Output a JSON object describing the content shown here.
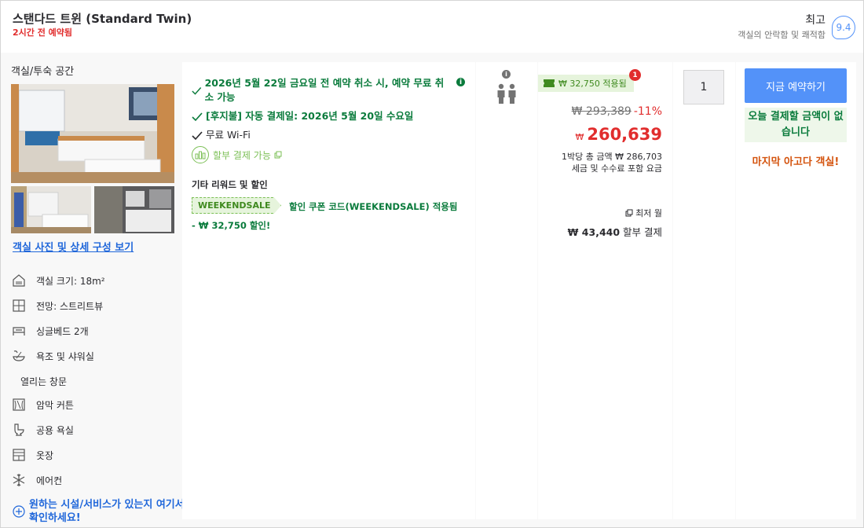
{
  "header": {
    "room_title": "스탠다드 트윈 (Standard Twin)",
    "recently_booked": "2시간 전 예약됨",
    "score_label": "최고",
    "score_sub": "객실의 안락함 및 쾌적함",
    "score": "9.4"
  },
  "left": {
    "section_label": "객실/투숙 공간",
    "photo_link": "객실 사진 및 상세 구성 보기",
    "features": [
      {
        "label": "객실 크기: 18m²",
        "icon": "room-size-icon"
      },
      {
        "label": "전망: 스트리트뷰",
        "icon": "view-icon"
      },
      {
        "label": "싱글베드 2개",
        "icon": "bed-icon"
      },
      {
        "label": "욕조 및 샤워실",
        "icon": "bath-icon"
      },
      {
        "label": "열리는 창문",
        "icon": ""
      },
      {
        "label": "암막 커튼",
        "icon": "curtain-icon"
      },
      {
        "label": "공용 욕실",
        "icon": "toilet-icon"
      },
      {
        "label": "옷장",
        "icon": "wardrobe-icon"
      },
      {
        "label": "에어컨",
        "icon": "snowflake-icon"
      }
    ],
    "more_link": "원하는 시설/서비스가 있는지 여기서 확인하세요!"
  },
  "benefits": {
    "cancel": "2026년 5월 22일 금요일 전 예약 취소 시, 예약 무료 취소 가능",
    "postpay": "[후지불] 자동 결제일: 2026년 5월 20일 수요일",
    "wifi": "무료 Wi-Fi",
    "installment": "할부 결제 가능",
    "rewards_title": "기타 리워드 및 할인",
    "coupon_code": "WEEKENDSALE",
    "coupon_text": "할인 쿠폰 코드(WEEKENDSALE) 적용됨",
    "coupon_save": "- ₩ 32,750 할인!"
  },
  "occupancy": {
    "info": "i"
  },
  "price": {
    "applied_badge": "₩ 32,750 적용됨",
    "badge_count": "1",
    "original": "₩ 293,389",
    "discount": "-11%",
    "currency": "₩",
    "final": "260,639",
    "per_night": "1박당 총 금액 ₩ 286,703",
    "tax_note": "세금 및 수수료 포함 요금",
    "monthly_label": "최저 월",
    "monthly_amount": "₩ 43,440",
    "monthly_suffix": " 할부 결제"
  },
  "quantity": {
    "value": "1"
  },
  "booking": {
    "button": "지금 예약하기",
    "pay_note": "오늘 결제할 금액이 없습니다",
    "last_room": "마지막 아고다 객실!"
  },
  "colors": {
    "accent_blue": "#5392f9",
    "green": "#0a7b3c",
    "red": "#e12d2d",
    "orange": "#d4530d"
  }
}
